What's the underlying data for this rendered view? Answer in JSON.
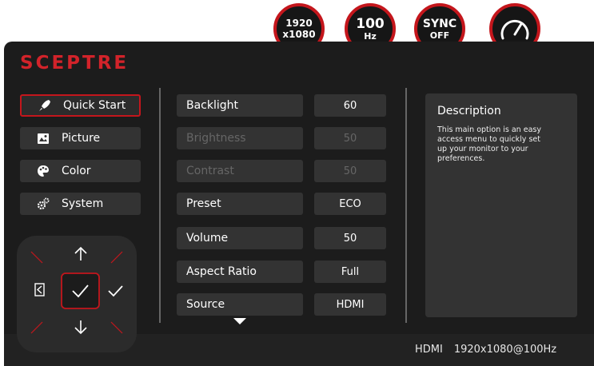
{
  "badges": {
    "resolution": {
      "line1": "1920",
      "line2": "x1080"
    },
    "refresh": {
      "line1": "100",
      "line2": "Hz"
    },
    "sync": {
      "line1": "SYNC",
      "line2": "OFF"
    },
    "gauge_icon": "speedometer-icon"
  },
  "brand": {
    "logo_text": "SCEPTRE"
  },
  "menu": [
    {
      "label": "Quick Start",
      "icon": "rocket-icon",
      "active": true
    },
    {
      "label": "Picture",
      "icon": "picture-icon",
      "active": false
    },
    {
      "label": "Color",
      "icon": "color-palette-icon",
      "active": false
    },
    {
      "label": "System",
      "icon": "gears-icon",
      "active": false
    }
  ],
  "settings": [
    {
      "label": "Backlight",
      "value": "60",
      "enabled": true
    },
    {
      "label": "Brightness",
      "value": "50",
      "enabled": false
    },
    {
      "label": "Contrast",
      "value": "50",
      "enabled": false
    },
    {
      "label": "Preset",
      "value": "ECO",
      "enabled": true
    },
    {
      "label": "Volume",
      "value": "50",
      "enabled": true
    },
    {
      "label": "Aspect Ratio",
      "value": "Full",
      "enabled": true
    },
    {
      "label": "Source",
      "value": "HDMI",
      "enabled": true
    }
  ],
  "more_indicator_icon": "triangle-down-icon",
  "description": {
    "title": "Description",
    "body": "This main option is an easy access menu to quickly set up your monitor to your preferences."
  },
  "nav_pad_icons": [
    "arrow-up-icon",
    "arrow-down-icon",
    "exit-icon",
    "check-icon",
    "check-icon"
  ],
  "status": {
    "input": "HDMI",
    "mode": "1920x1080@100Hz"
  },
  "colors": {
    "accent": "#c4161c",
    "panel": "#1c1c1c",
    "control": "#333333",
    "disabled_text": "#666666"
  }
}
